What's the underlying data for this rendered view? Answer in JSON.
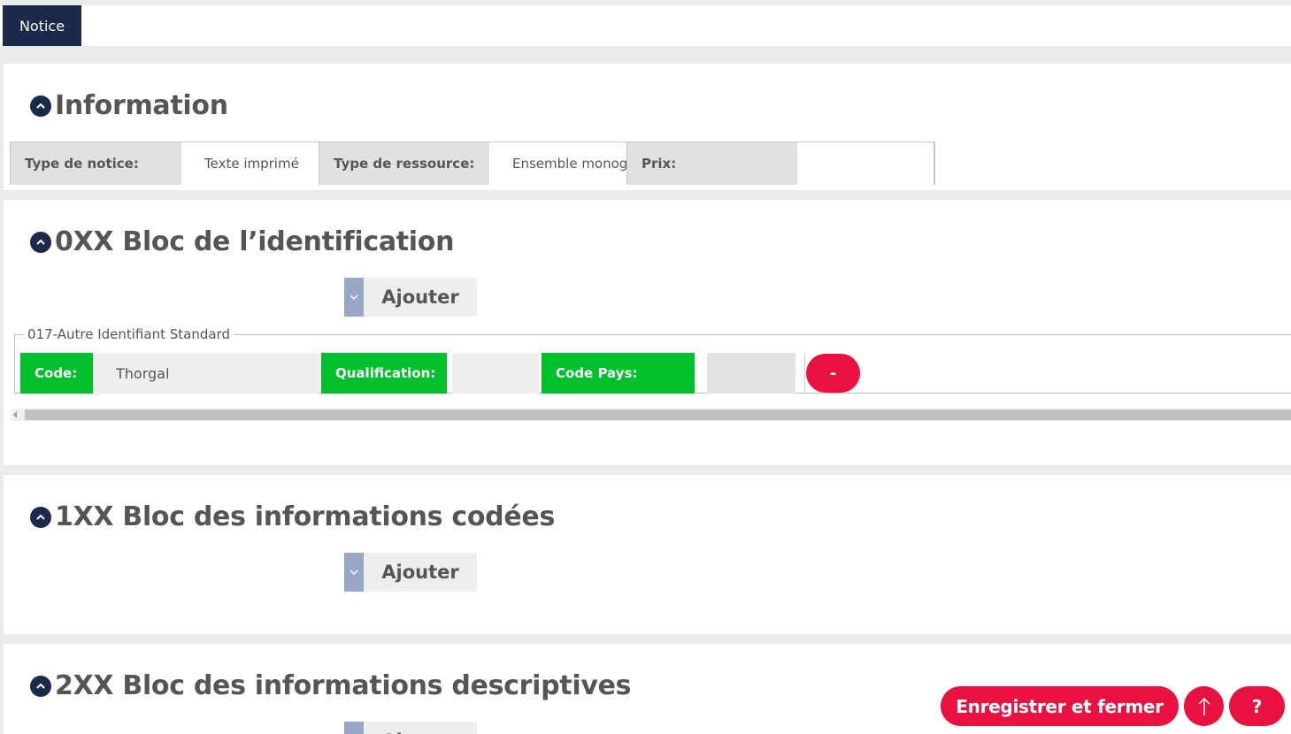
{
  "tabs": {
    "notice": "Notice"
  },
  "information": {
    "title": "Information",
    "fields": [
      {
        "label": "Type de notice:",
        "value": "Texte imprimé"
      },
      {
        "label": "Type de ressource:",
        "value": "Ensemble monographique"
      },
      {
        "label": "Prix:",
        "value": ""
      }
    ]
  },
  "bloc0": {
    "title": "0XX Bloc de l’identification",
    "add_label": "Ajouter",
    "group_legend": "017-Autre Identifiant Standard",
    "code_label": "Code:",
    "code_value": "Thorgal",
    "qualification_label": "Qualification:",
    "qualification_value": "",
    "code_pays_label": "Code Pays:",
    "code_pays_value": "",
    "remove_label": "-"
  },
  "bloc1": {
    "title": "1XX Bloc des informations codées",
    "add_label": "Ajouter"
  },
  "bloc2": {
    "title": "2XX Bloc des informations descriptives",
    "add_label": "Ajouter"
  },
  "footer": {
    "save_close": "Enregistrer et fermer",
    "help": "?"
  },
  "colors": {
    "navy": "#1b2a4a",
    "accent_red": "#e8113f",
    "green": "#00c12b",
    "dropdown_blue": "#99a7c6"
  }
}
